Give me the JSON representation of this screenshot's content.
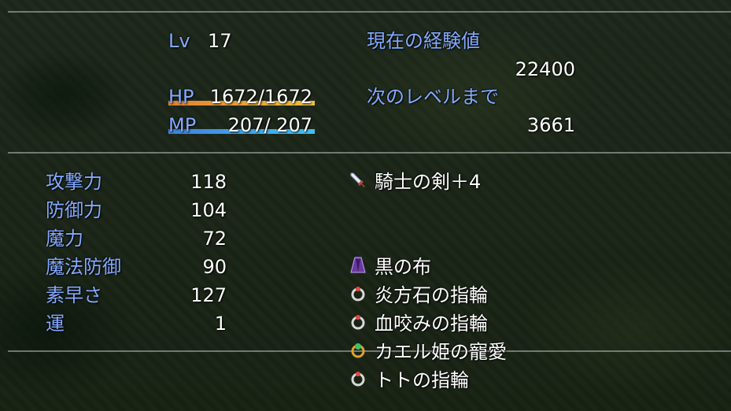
{
  "status": {
    "level_label": "Lv",
    "level_value": "17",
    "hp_label": "HP",
    "hp_value": "1672/1672",
    "hp_fill": 1.0,
    "mp_label": "MP",
    "mp_value": " 207/ 207",
    "mp_fill": 1.0,
    "exp_label": "現在の経験値",
    "exp_value": "22400",
    "next_label": "次のレベルまで",
    "next_value": "3661"
  },
  "params": [
    {
      "label": "攻撃力",
      "value": "118"
    },
    {
      "label": "防御力",
      "value": "104"
    },
    {
      "label": "魔力",
      "value": "72"
    },
    {
      "label": "魔法防御",
      "value": "90"
    },
    {
      "label": "素早さ",
      "value": "127"
    },
    {
      "label": "運",
      "value": "1"
    }
  ],
  "equipment": [
    {
      "icon": "sword-icon",
      "name": "騎士の剣＋4"
    },
    {
      "icon": "",
      "name": ""
    },
    {
      "icon": "",
      "name": ""
    },
    {
      "icon": "cloak-icon",
      "name": "黒の布"
    },
    {
      "icon": "ring-icon",
      "name": "炎方石の指輪"
    },
    {
      "icon": "ring-icon",
      "name": "血咬みの指輪"
    },
    {
      "icon": "gem-ring-icon",
      "name": "カエル姫の寵愛"
    },
    {
      "icon": "ring-icon",
      "name": "トトの指輪"
    }
  ],
  "colors": {
    "system_text": "#84aaff",
    "hp_gauge": [
      "#e08030",
      "#f0c040"
    ],
    "mp_gauge": [
      "#4080e0",
      "#40c0f0"
    ],
    "divider": "#bebebe"
  }
}
